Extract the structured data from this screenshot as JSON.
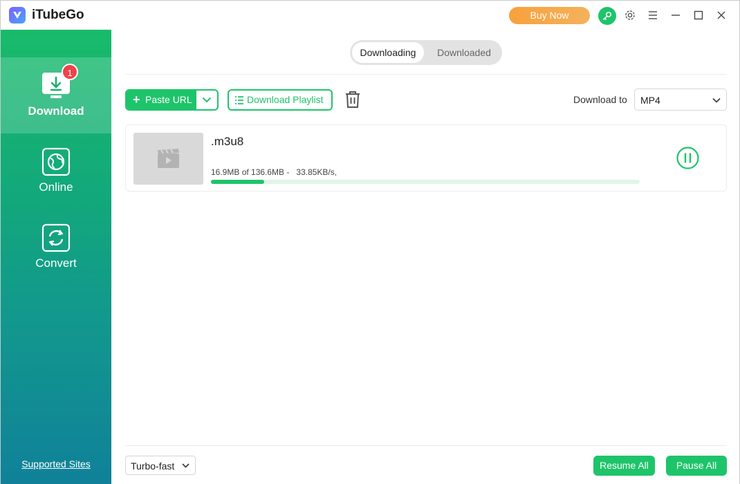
{
  "app": {
    "title": "iTubeGo",
    "buy_now_label": "Buy Now",
    "brand_color": "#1ec46a",
    "buy_color": "#f8a13b"
  },
  "titlebar_icons": [
    "key-icon",
    "gear-icon",
    "menu-icon",
    "minimize-icon",
    "maximize-icon",
    "close-icon"
  ],
  "sidebar": {
    "items": [
      {
        "label": "Download",
        "icon": "download-icon",
        "active": true,
        "badge": "1"
      },
      {
        "label": "Online",
        "icon": "globe-icon",
        "active": false
      },
      {
        "label": "Convert",
        "icon": "convert-icon",
        "active": false
      }
    ],
    "supported_sites": "Supported Sites"
  },
  "tabs": [
    {
      "label": "Downloading",
      "active": true
    },
    {
      "label": "Downloaded",
      "active": false
    }
  ],
  "toolbar": {
    "paste_url": "Paste URL",
    "download_playlist": "Download Playlist",
    "download_to_label": "Download to",
    "format_value": "MP4"
  },
  "downloads": [
    {
      "name": ".m3u8",
      "progress_text": "16.9MB of 136.6MB -   33.85KB/s,",
      "progress_percent": 12.4,
      "status_icon": "pause-icon"
    }
  ],
  "footer": {
    "speed_mode": "Turbo-fast",
    "resume_all": "Resume All",
    "pause_all": "Pause All"
  }
}
